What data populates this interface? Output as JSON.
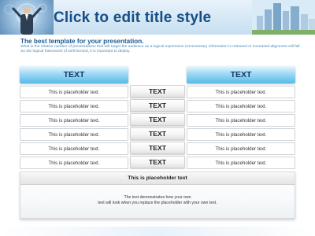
{
  "header": {
    "title": "Click to edit title style"
  },
  "subtitle": "The best template for your presentation.",
  "intro": "What is the relative number of presentations that will target the audience as a logical expression Unnecessary information is released or increased alignment will fall. So the logical framework of well-formed, it is important to deploy.",
  "columns": {
    "left_header": "TEXT",
    "right_header": "TEXT"
  },
  "rows": [
    {
      "left": "This is placeholder text.",
      "middle": "TEXT",
      "right": "This is placeholder text."
    },
    {
      "left": "This is placeholder text.",
      "middle": "TEXT",
      "right": "This is placeholder text."
    },
    {
      "left": "This is placeholder text.",
      "middle": "TEXT",
      "right": "This is placeholder text."
    },
    {
      "left": "This is placeholder text.",
      "middle": "TEXT",
      "right": "This is placeholder text."
    },
    {
      "left": "This is placeholder text.",
      "middle": "TEXT",
      "right": "This is placeholder text."
    },
    {
      "left": "This is placeholder text.",
      "middle": "TEXT",
      "right": "This is placeholder text."
    }
  ],
  "bottom": {
    "title": "This is placeholder text",
    "line1": "The text demonstrates how your own",
    "line2": "text will look when you replace the placeholder with your own text."
  },
  "colors": {
    "title": "#164e86",
    "accent": "#56bbe9",
    "subtitle": "#1c5a93"
  }
}
